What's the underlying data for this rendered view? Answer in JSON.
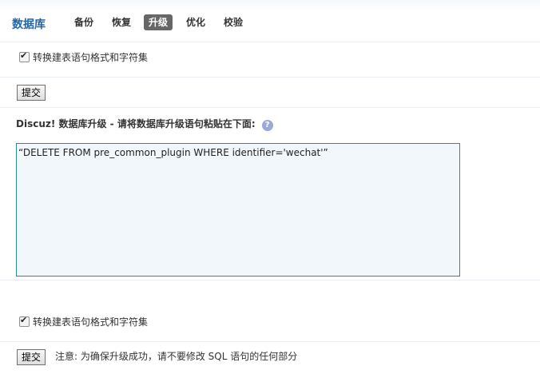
{
  "header": {
    "title": "数据库",
    "tabs": [
      {
        "label": "备份",
        "active": false
      },
      {
        "label": "恢复",
        "active": false
      },
      {
        "label": "升级",
        "active": true
      },
      {
        "label": "优化",
        "active": false
      },
      {
        "label": "校验",
        "active": false
      }
    ]
  },
  "top_option": {
    "checkbox_label": "转换建表语句格式和字符集",
    "checked": true,
    "submit_label": "提交"
  },
  "upgrade": {
    "section_title": "Discuz! 数据库升级 - 请将数据库升级语句粘贴在下面:",
    "help_icon": "question-icon",
    "sql_value": "“DELETE FROM pre_common_plugin WHERE identifier='wechat'”"
  },
  "bottom_option": {
    "checkbox_label": "转换建表语句格式和字符集",
    "checked": true,
    "submit_label": "提交",
    "note": "注意: 为确保升级成功，请不要修改 SQL 语句的任何部分"
  },
  "colors": {
    "title": "#2366a8",
    "active_tab_bg": "#676767",
    "textarea_border": "#2a8c8c",
    "textarea_bg": "#f1f7fa",
    "help_icon_bg": "#9aa9d6"
  }
}
